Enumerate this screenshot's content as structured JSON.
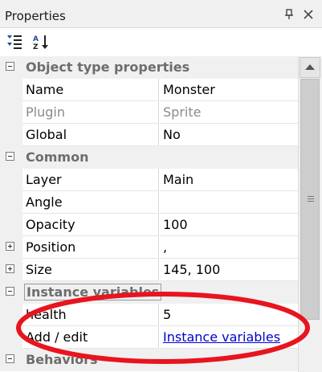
{
  "panel": {
    "title": "Properties",
    "pin_icon": "pin-icon",
    "close_icon": "close-icon"
  },
  "toolbar": {
    "categorize_icon": "categorized-view-icon",
    "alpha_icon": "alphabetical-sort-icon"
  },
  "categories": {
    "object_type": "Object type properties",
    "common": "Common",
    "instance_vars": "Instance variables",
    "behaviors": "Behaviors"
  },
  "rows": {
    "name": {
      "label": "Name",
      "value": "Monster"
    },
    "plugin": {
      "label": "Plugin",
      "value": "Sprite"
    },
    "global": {
      "label": "Global",
      "value": "No"
    },
    "layer": {
      "label": "Layer",
      "value": "Main"
    },
    "angle": {
      "label": "Angle",
      "value": ""
    },
    "opacity": {
      "label": "Opacity",
      "value": "100"
    },
    "position": {
      "label": "Position",
      "value": ","
    },
    "size": {
      "label": "Size",
      "value": "145, 100"
    },
    "health": {
      "label": "health",
      "value": "5"
    },
    "add_edit": {
      "label": "Add / edit",
      "value": "Instance variables"
    }
  },
  "colors": {
    "link": "#0000cc",
    "annotation": "#e8141e",
    "category_text": "#6d6d6d",
    "disabled_text": "#8a8a8a"
  }
}
